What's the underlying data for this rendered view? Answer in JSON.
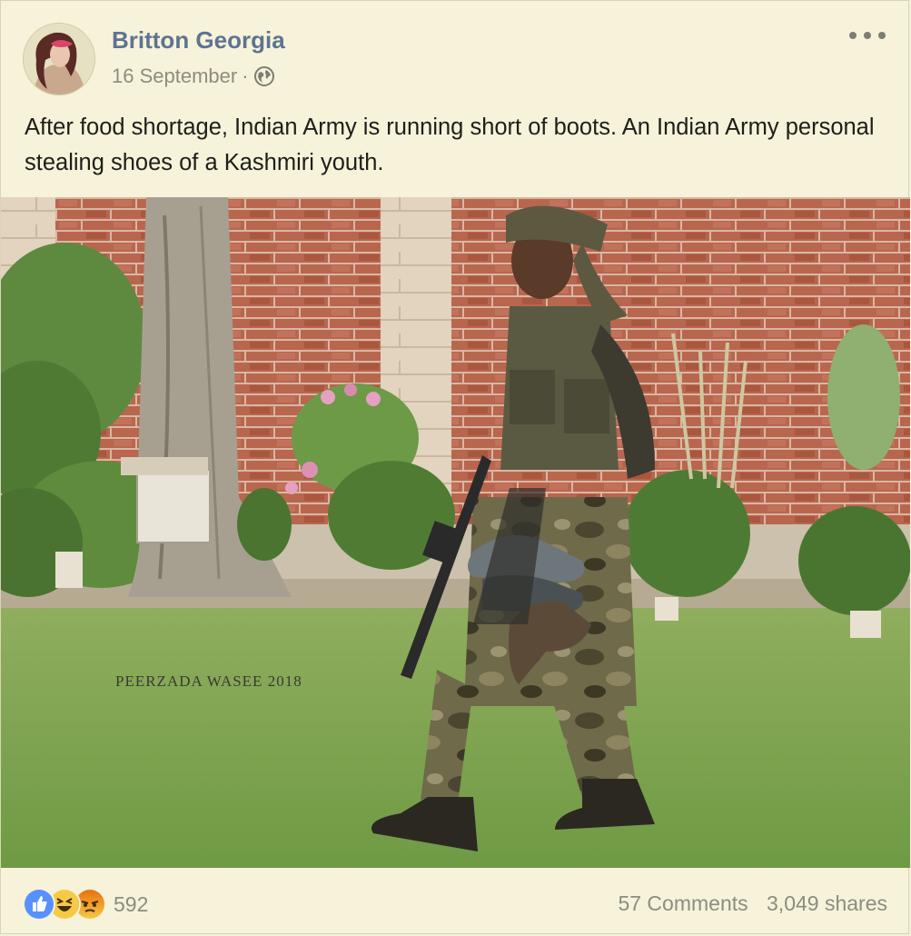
{
  "post": {
    "author_name": "Britton Georgia",
    "date": "16 September",
    "separator": "·",
    "privacy_icon": "globe-icon",
    "more_icon": "more-options-icon",
    "text": "After food shortage, Indian Army is running short of boots. An Indian Army personal stealing shoes of a Kashmiri youth.",
    "photo": {
      "watermark": "PEERZADA WASEE 2018"
    }
  },
  "footer": {
    "reactions": [
      "like-icon",
      "haha-icon",
      "angry-icon"
    ],
    "reaction_count": "592",
    "comments": "57 Comments",
    "shares": "3,049 shares"
  },
  "colors": {
    "author": "#5f7391",
    "meta": "#8b8d80",
    "background": "#f6f3da",
    "like": "#5890ff",
    "haha": "#f7c945",
    "angry": "#e9710f"
  }
}
